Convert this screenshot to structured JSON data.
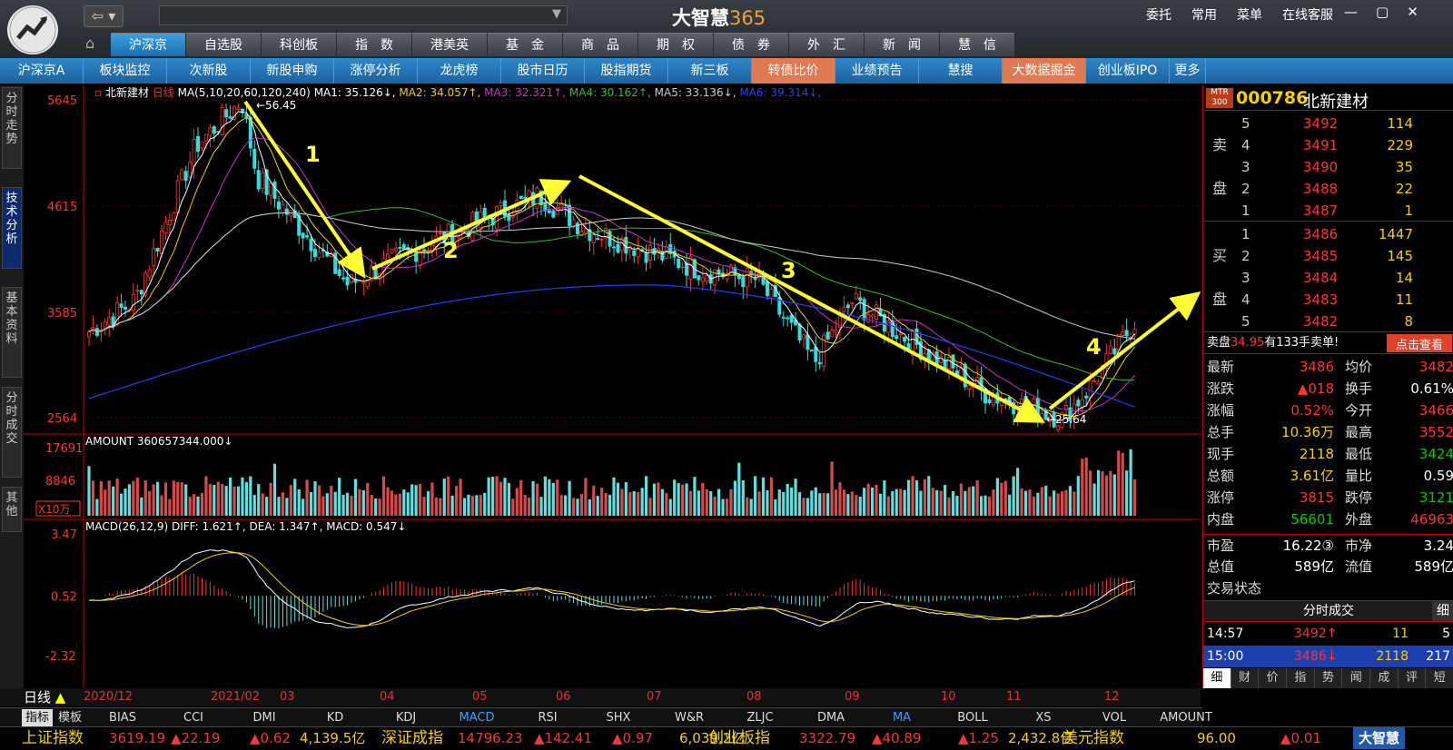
{
  "app": {
    "title_main": "大智慧",
    "title_num": "365"
  },
  "topmenu": [
    "委托",
    "常用",
    "菜单",
    "在线客服"
  ],
  "window_controls": [
    "—",
    "▢",
    "✕"
  ],
  "tabs1": [
    {
      "label": "沪深京",
      "active": true
    },
    {
      "label": "自选股"
    },
    {
      "label": "科创板"
    },
    {
      "label": "指　数"
    },
    {
      "label": "港美英"
    },
    {
      "label": "基　金"
    },
    {
      "label": "商　品"
    },
    {
      "label": "期　权"
    },
    {
      "label": "债　券"
    },
    {
      "label": "外　汇"
    },
    {
      "label": "新　闻"
    },
    {
      "label": "慧　信"
    }
  ],
  "tabs2": [
    {
      "label": "沪深京A"
    },
    {
      "label": "板块监控"
    },
    {
      "label": "次新股"
    },
    {
      "label": "新股申购"
    },
    {
      "label": "涨停分析"
    },
    {
      "label": "龙虎榜"
    },
    {
      "label": "股市日历"
    },
    {
      "label": "股指期货"
    },
    {
      "label": "新三板"
    },
    {
      "label": "转债比价",
      "hot": true
    },
    {
      "label": "业绩预告"
    },
    {
      "label": "慧搜"
    },
    {
      "label": "大数据掘金",
      "hot": true
    },
    {
      "label": "创业板IPO"
    },
    {
      "label": "更多"
    }
  ],
  "vtabs": [
    {
      "label": "分时走势"
    },
    {
      "label": "技术分析",
      "active": true
    },
    {
      "label": "基本资料"
    },
    {
      "label": "分时成交"
    },
    {
      "label": "其他"
    }
  ],
  "chart_data": {
    "type": "candlestick",
    "title": "北新建材",
    "period_label": "日线",
    "ma_header": "MA(5,10,20,60,120,240)",
    "ma_values": [
      {
        "name": "MA1",
        "value": "35.126",
        "arrow": "↓",
        "color": "#ffffff"
      },
      {
        "name": "MA2",
        "value": "34.057",
        "arrow": "↑",
        "color": "#f5d000"
      },
      {
        "name": "MA3",
        "value": "32.321",
        "arrow": "↑",
        "color": "#d030d0"
      },
      {
        "name": "MA4",
        "value": "30.162",
        "arrow": "↑",
        "color": "#30c030"
      },
      {
        "name": "MA5",
        "value": "33.136",
        "arrow": "↓",
        "color": "#cccccc"
      },
      {
        "name": "MA6",
        "value": "39.314",
        "arrow": "↓",
        "color": "#2040ff"
      }
    ],
    "price_axis_ticks": [
      "5645",
      "4615",
      "3585",
      "2564"
    ],
    "price_high_label": "56.45",
    "price_low_label": "25.64",
    "annotations": [
      "1",
      "2",
      "3",
      "4"
    ],
    "amount_label": "AMOUNT 360657344.000",
    "amount_arrow": "↓",
    "amount_axis_ticks": [
      "17691",
      "8846"
    ],
    "amount_unit": "X10万",
    "macd_label": "MACD(26,12,9)",
    "macd_values": {
      "diff": "1.621",
      "dea": "1.347",
      "macd": "0.547"
    },
    "macd_axis_ticks": [
      "3.47",
      "0.52",
      "-2.32"
    ],
    "x_labels": [
      "2020/12",
      "2021/02",
      "03",
      "04",
      "05",
      "06",
      "07",
      "08",
      "09",
      "10",
      "11",
      "12"
    ]
  },
  "stock": {
    "badge": "MTR 300",
    "code": "000786",
    "name": "北新建材"
  },
  "sell_label": [
    "卖",
    "盘"
  ],
  "buy_label": [
    "买",
    "盘"
  ],
  "asks": [
    {
      "level": "5",
      "price": "3492",
      "vol": "114"
    },
    {
      "level": "4",
      "price": "3491",
      "vol": "229"
    },
    {
      "level": "3",
      "price": "3490",
      "vol": "35"
    },
    {
      "level": "2",
      "price": "3488",
      "vol": "22"
    },
    {
      "level": "1",
      "price": "3487",
      "vol": "1"
    }
  ],
  "bids": [
    {
      "level": "1",
      "price": "3486",
      "vol": "1447"
    },
    {
      "level": "2",
      "price": "3485",
      "vol": "145"
    },
    {
      "level": "3",
      "price": "3484",
      "vol": "14"
    },
    {
      "level": "4",
      "price": "3483",
      "vol": "11"
    },
    {
      "level": "5",
      "price": "3482",
      "vol": "8"
    }
  ],
  "notice": {
    "prefix": "卖盘",
    "price": "34.95",
    "suffix": "有133手卖单!",
    "button": "点击查看"
  },
  "quote": [
    {
      "k1": "最新",
      "v1": "3486",
      "c1": "red",
      "k2": "均价",
      "v2": "3482",
      "c2": "red"
    },
    {
      "k1": "涨跌",
      "v1": "▲018",
      "c1": "red",
      "k2": "换手",
      "v2": "0.61%",
      "c2": "wht"
    },
    {
      "k1": "涨幅",
      "v1": "0.52%",
      "c1": "red",
      "k2": "今开",
      "v2": "3466",
      "c2": "red"
    },
    {
      "k1": "总手",
      "v1": "10.36万",
      "c1": "yel",
      "k2": "最高",
      "v2": "3552",
      "c2": "red"
    },
    {
      "k1": "现手",
      "v1": "2118",
      "c1": "yel",
      "k2": "最低",
      "v2": "3424",
      "c2": "grn"
    },
    {
      "k1": "总额",
      "v1": "3.61亿",
      "c1": "yel",
      "k2": "量比",
      "v2": "0.59",
      "c2": "wht"
    },
    {
      "k1": "涨停",
      "v1": "3815",
      "c1": "red",
      "k2": "跌停",
      "v2": "3121",
      "c2": "grn"
    },
    {
      "k1": "内盘",
      "v1": "56601",
      "c1": "grn",
      "k2": "外盘",
      "v2": "46963",
      "c2": "red"
    },
    {
      "k1": "市盈",
      "v1": "16.22③",
      "c1": "wht",
      "k2": "市净",
      "v2": "3.24",
      "c2": "wht"
    },
    {
      "k1": "总值",
      "v1": "589亿",
      "c1": "wht",
      "k2": "流值",
      "v2": "589亿",
      "c2": "wht"
    },
    {
      "k1": "交易状态",
      "v1": "",
      "c1": "wht",
      "k2": "",
      "v2": "",
      "c2": "wht"
    }
  ],
  "ticks_head": "分时成交",
  "ticks_corner": "细",
  "ticks": [
    {
      "time": "14:57",
      "price": "3492↑",
      "vol": "11",
      "n": "5"
    },
    {
      "time": "15:00",
      "price": "3486↓",
      "vol": "2118",
      "n": "217"
    }
  ],
  "rp_tabs": [
    "细",
    "财",
    "价",
    "指",
    "势",
    "闻",
    "成",
    "评",
    "短"
  ],
  "indicator_tabs": [
    "指标",
    "模板",
    "BIAS",
    "CCI",
    "DMI",
    "KD",
    "KDJ",
    "MACD",
    "RSI",
    "SHX",
    "W&R",
    "ZLJC",
    "DMA",
    "MA",
    "BOLL",
    "XS",
    "VOL",
    "AMOUNT"
  ],
  "ticker": [
    {
      "name": "上证指数",
      "price": "3619.19",
      "chg": "▲22.19",
      "pct": "▲0.62",
      "amt": "4,139.5亿"
    },
    {
      "name": "深证成指",
      "price": "14796.23",
      "chg": "▲142.41",
      "pct": "▲0.97",
      "amt": "6,039.2亿"
    },
    {
      "name": "创业板指",
      "price": "3322.79",
      "chg": "▲40.89",
      "pct": "▲1.25",
      "amt": "2,432.8亿"
    },
    {
      "name": "美元指数",
      "price": "96.00",
      "chg": "",
      "pct": "▲0.01",
      "amt": ""
    }
  ],
  "ticker_brand": "大智慧",
  "colors": {
    "up": "#ff3333",
    "down": "#33dddd",
    "ma5": "#ffffff",
    "ma10": "#f5d000",
    "ma20": "#d030d0",
    "ma60": "#30c030",
    "ma120": "#cccccc",
    "ma240": "#2040ff",
    "annot": "#ffff33",
    "axis_red": "#cc0000"
  }
}
